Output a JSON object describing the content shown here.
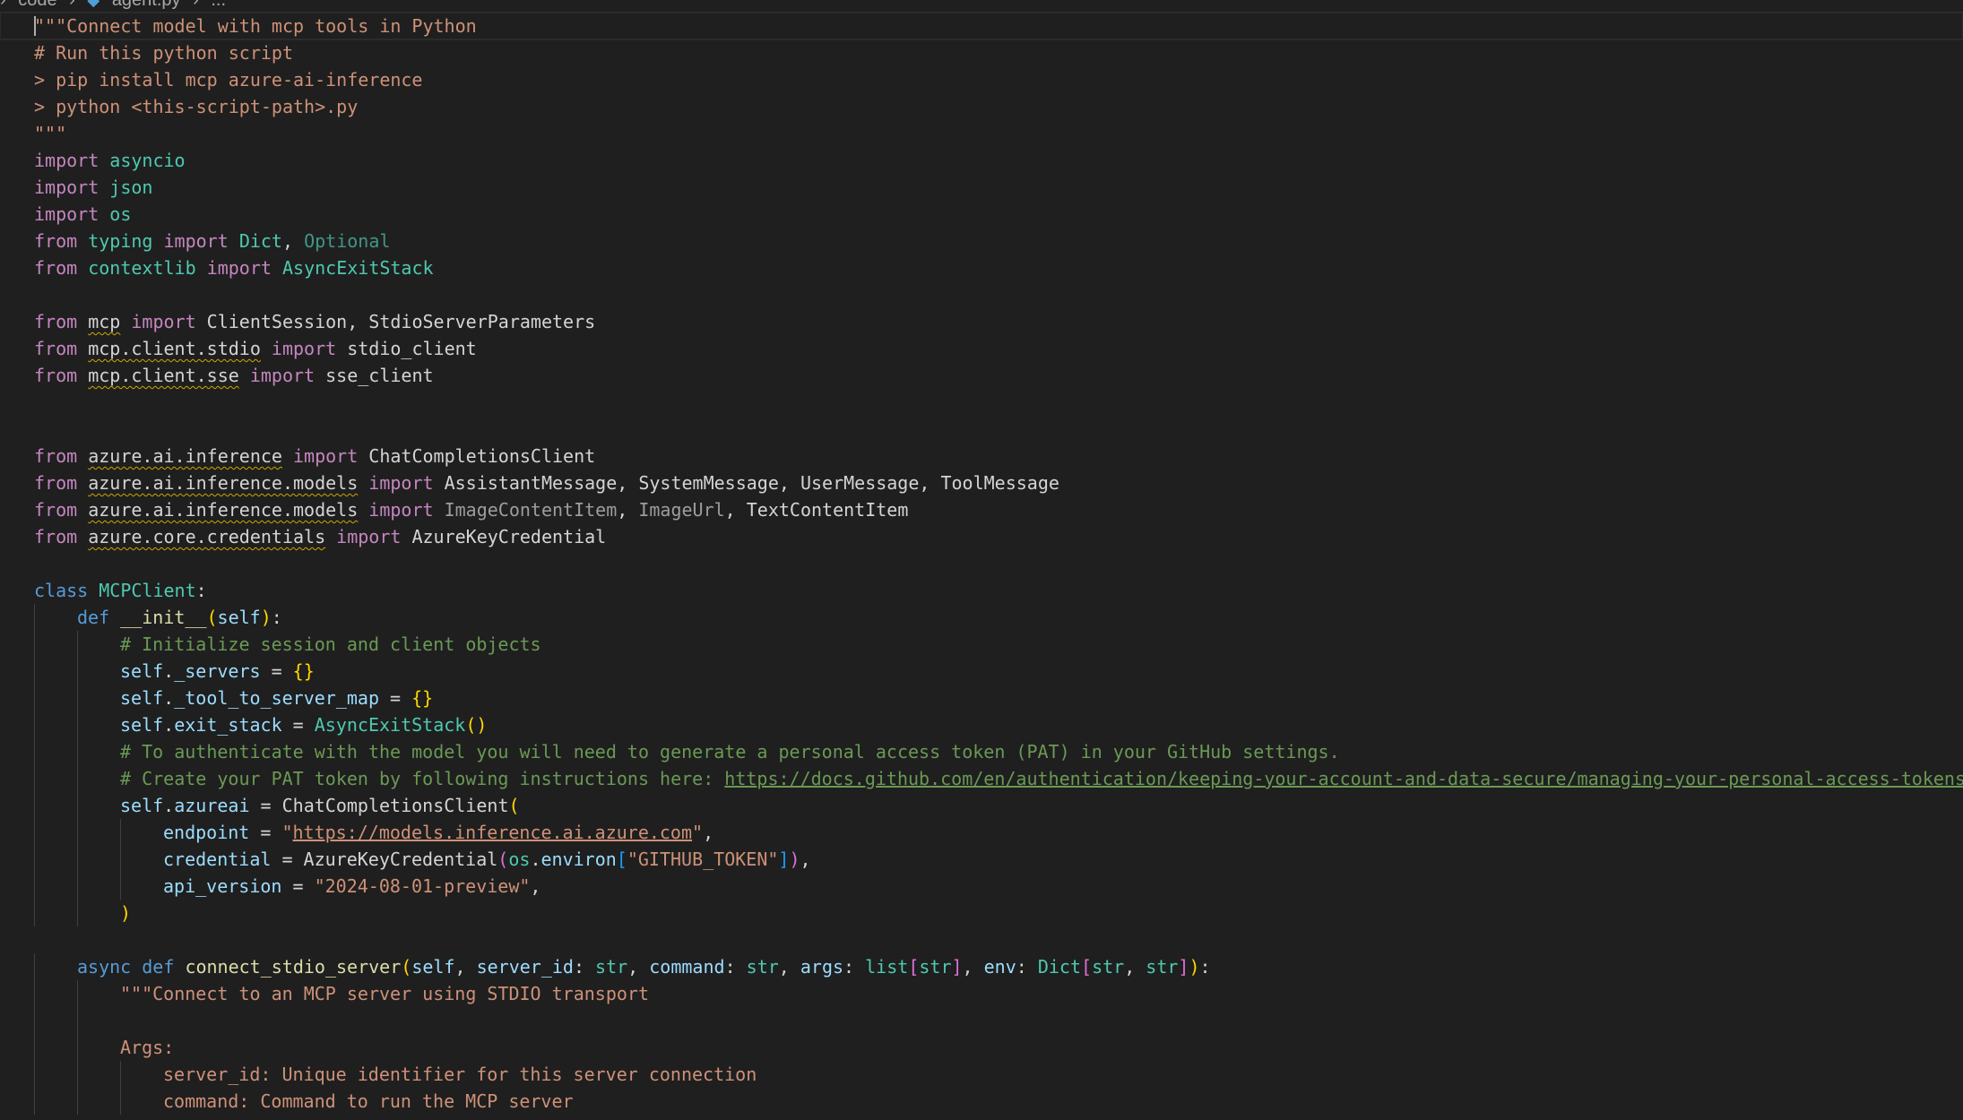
{
  "breadcrumb": {
    "folder": "code",
    "file": "agent.py",
    "more": "..."
  },
  "lines": [
    {
      "indent": 0,
      "current": true,
      "tokens": [
        {
          "t": "\"\"\"Connect model with mcp tools in Python",
          "c": "str"
        }
      ]
    },
    {
      "indent": 0,
      "tokens": [
        {
          "t": "# Run this python script",
          "c": "str"
        }
      ]
    },
    {
      "indent": 0,
      "tokens": [
        {
          "t": "> pip install mcp azure-ai-inference",
          "c": "str"
        }
      ]
    },
    {
      "indent": 0,
      "tokens": [
        {
          "t": "> python <this-script-path>.py",
          "c": "str"
        }
      ]
    },
    {
      "indent": 0,
      "tokens": [
        {
          "t": "\"\"\"",
          "c": "str"
        }
      ]
    },
    {
      "indent": 0,
      "tokens": [
        {
          "t": "import",
          "c": "kw"
        },
        {
          "t": " ",
          "c": "plain"
        },
        {
          "t": "asyncio",
          "c": "mod"
        }
      ]
    },
    {
      "indent": 0,
      "tokens": [
        {
          "t": "import",
          "c": "kw"
        },
        {
          "t": " ",
          "c": "plain"
        },
        {
          "t": "json",
          "c": "mod"
        }
      ]
    },
    {
      "indent": 0,
      "tokens": [
        {
          "t": "import",
          "c": "kw"
        },
        {
          "t": " ",
          "c": "plain"
        },
        {
          "t": "os",
          "c": "mod"
        }
      ]
    },
    {
      "indent": 0,
      "tokens": [
        {
          "t": "from",
          "c": "kw"
        },
        {
          "t": " ",
          "c": "plain"
        },
        {
          "t": "typing",
          "c": "mod"
        },
        {
          "t": " ",
          "c": "plain"
        },
        {
          "t": "import",
          "c": "kw"
        },
        {
          "t": " ",
          "c": "plain"
        },
        {
          "t": "Dict",
          "c": "cls"
        },
        {
          "t": ", ",
          "c": "plain"
        },
        {
          "t": "Optional",
          "c": "opt"
        }
      ]
    },
    {
      "indent": 0,
      "tokens": [
        {
          "t": "from",
          "c": "kw"
        },
        {
          "t": " ",
          "c": "plain"
        },
        {
          "t": "contextlib",
          "c": "mod"
        },
        {
          "t": " ",
          "c": "plain"
        },
        {
          "t": "import",
          "c": "kw"
        },
        {
          "t": " ",
          "c": "plain"
        },
        {
          "t": "AsyncExitStack",
          "c": "cls"
        }
      ]
    },
    {
      "indent": 0,
      "tokens": []
    },
    {
      "indent": 0,
      "tokens": [
        {
          "t": "from",
          "c": "kw"
        },
        {
          "t": " ",
          "c": "plain"
        },
        {
          "t": "mcp",
          "c": "plain",
          "sq": true
        },
        {
          "t": " ",
          "c": "plain"
        },
        {
          "t": "import",
          "c": "kw"
        },
        {
          "t": " ClientSession, StdioServerParameters",
          "c": "plain"
        }
      ]
    },
    {
      "indent": 0,
      "tokens": [
        {
          "t": "from",
          "c": "kw"
        },
        {
          "t": " ",
          "c": "plain"
        },
        {
          "t": "mcp.client.stdio",
          "c": "plain",
          "sq": true
        },
        {
          "t": " ",
          "c": "plain"
        },
        {
          "t": "import",
          "c": "kw"
        },
        {
          "t": " stdio_client",
          "c": "plain"
        }
      ]
    },
    {
      "indent": 0,
      "tokens": [
        {
          "t": "from",
          "c": "kw"
        },
        {
          "t": " ",
          "c": "plain"
        },
        {
          "t": "mcp.client.sse",
          "c": "plain",
          "sq": true
        },
        {
          "t": " ",
          "c": "plain"
        },
        {
          "t": "import",
          "c": "kw"
        },
        {
          "t": " sse_client",
          "c": "plain"
        }
      ]
    },
    {
      "indent": 0,
      "tokens": []
    },
    {
      "indent": 0,
      "tokens": []
    },
    {
      "indent": 0,
      "tokens": [
        {
          "t": "from",
          "c": "kw"
        },
        {
          "t": " ",
          "c": "plain"
        },
        {
          "t": "azure.ai.inference",
          "c": "plain",
          "sq": true
        },
        {
          "t": " ",
          "c": "plain"
        },
        {
          "t": "import",
          "c": "kw"
        },
        {
          "t": " ChatCompletionsClient",
          "c": "plain"
        }
      ]
    },
    {
      "indent": 0,
      "tokens": [
        {
          "t": "from",
          "c": "kw"
        },
        {
          "t": " ",
          "c": "plain"
        },
        {
          "t": "azure.ai.inference.models",
          "c": "plain",
          "sq": true
        },
        {
          "t": " ",
          "c": "plain"
        },
        {
          "t": "import",
          "c": "kw"
        },
        {
          "t": " AssistantMessage, SystemMessage, UserMessage, ToolMessage",
          "c": "plain"
        }
      ]
    },
    {
      "indent": 0,
      "tokens": [
        {
          "t": "from",
          "c": "kw"
        },
        {
          "t": " ",
          "c": "plain"
        },
        {
          "t": "azure.ai.inference.models",
          "c": "plain",
          "sq": true
        },
        {
          "t": " ",
          "c": "plain"
        },
        {
          "t": "import",
          "c": "kw"
        },
        {
          "t": " ",
          "c": "plain"
        },
        {
          "t": "ImageContentItem",
          "c": "dim"
        },
        {
          "t": ", ",
          "c": "plain"
        },
        {
          "t": "ImageUrl",
          "c": "dim"
        },
        {
          "t": ", TextContentItem",
          "c": "plain"
        }
      ]
    },
    {
      "indent": 0,
      "tokens": [
        {
          "t": "from",
          "c": "kw"
        },
        {
          "t": " ",
          "c": "plain"
        },
        {
          "t": "azure.core.credentials",
          "c": "plain",
          "sq": true
        },
        {
          "t": " ",
          "c": "plain"
        },
        {
          "t": "import",
          "c": "kw"
        },
        {
          "t": " AzureKeyCredential",
          "c": "plain"
        }
      ]
    },
    {
      "indent": 0,
      "tokens": []
    },
    {
      "indent": 0,
      "tokens": [
        {
          "t": "class",
          "c": "kw2"
        },
        {
          "t": " ",
          "c": "plain"
        },
        {
          "t": "MCPClient",
          "c": "cls"
        },
        {
          "t": ":",
          "c": "plain"
        }
      ]
    },
    {
      "indent": 1,
      "tokens": [
        {
          "t": "def",
          "c": "kw2"
        },
        {
          "t": " ",
          "c": "plain"
        },
        {
          "t": "__init__",
          "c": "fn"
        },
        {
          "t": "(",
          "c": "br1"
        },
        {
          "t": "self",
          "c": "var"
        },
        {
          "t": ")",
          "c": "br1"
        },
        {
          "t": ":",
          "c": "plain"
        }
      ]
    },
    {
      "indent": 2,
      "tokens": [
        {
          "t": "# Initialize session and client objects",
          "c": "cmt"
        }
      ]
    },
    {
      "indent": 2,
      "tokens": [
        {
          "t": "self",
          "c": "var"
        },
        {
          "t": ".",
          "c": "plain"
        },
        {
          "t": "_servers",
          "c": "var"
        },
        {
          "t": " = ",
          "c": "plain"
        },
        {
          "t": "{}",
          "c": "br1"
        }
      ]
    },
    {
      "indent": 2,
      "tokens": [
        {
          "t": "self",
          "c": "var"
        },
        {
          "t": ".",
          "c": "plain"
        },
        {
          "t": "_tool_to_server_map",
          "c": "var"
        },
        {
          "t": " = ",
          "c": "plain"
        },
        {
          "t": "{}",
          "c": "br1"
        }
      ]
    },
    {
      "indent": 2,
      "tokens": [
        {
          "t": "self",
          "c": "var"
        },
        {
          "t": ".",
          "c": "plain"
        },
        {
          "t": "exit_stack",
          "c": "var"
        },
        {
          "t": " = ",
          "c": "plain"
        },
        {
          "t": "AsyncExitStack",
          "c": "cls"
        },
        {
          "t": "()",
          "c": "br1"
        }
      ]
    },
    {
      "indent": 2,
      "tokens": [
        {
          "t": "# To authenticate with the model you will need to generate a personal access token (PAT) in your GitHub settings.",
          "c": "cmt"
        }
      ]
    },
    {
      "indent": 2,
      "tokens": [
        {
          "t": "# Create your PAT token by following instructions here: ",
          "c": "cmt"
        },
        {
          "t": "https://docs.github.com/en/authentication/keeping-your-account-and-data-secure/managing-your-personal-access-tokens",
          "c": "cmt",
          "link": true
        }
      ]
    },
    {
      "indent": 2,
      "tokens": [
        {
          "t": "self",
          "c": "var"
        },
        {
          "t": ".",
          "c": "plain"
        },
        {
          "t": "azureai",
          "c": "var"
        },
        {
          "t": " = ChatCompletionsClient",
          "c": "plain"
        },
        {
          "t": "(",
          "c": "br1"
        }
      ]
    },
    {
      "indent": 3,
      "tokens": [
        {
          "t": "endpoint",
          "c": "var"
        },
        {
          "t": " = ",
          "c": "plain"
        },
        {
          "t": "\"",
          "c": "str"
        },
        {
          "t": "https://models.inference.ai.azure.com",
          "c": "str",
          "link": true
        },
        {
          "t": "\"",
          "c": "str"
        },
        {
          "t": ",",
          "c": "plain"
        }
      ]
    },
    {
      "indent": 3,
      "tokens": [
        {
          "t": "credential",
          "c": "var"
        },
        {
          "t": " = AzureKeyCredential",
          "c": "plain"
        },
        {
          "t": "(",
          "c": "br2"
        },
        {
          "t": "os",
          "c": "mod"
        },
        {
          "t": ".",
          "c": "plain"
        },
        {
          "t": "environ",
          "c": "var"
        },
        {
          "t": "[",
          "c": "br3"
        },
        {
          "t": "\"GITHUB_TOKEN\"",
          "c": "str"
        },
        {
          "t": "]",
          "c": "br3"
        },
        {
          "t": ")",
          "c": "br2"
        },
        {
          "t": ",",
          "c": "plain"
        }
      ]
    },
    {
      "indent": 3,
      "tokens": [
        {
          "t": "api_version",
          "c": "var"
        },
        {
          "t": " = ",
          "c": "plain"
        },
        {
          "t": "\"2024-08-01-preview\"",
          "c": "str"
        },
        {
          "t": ",",
          "c": "plain"
        }
      ]
    },
    {
      "indent": 2,
      "tokens": [
        {
          "t": ")",
          "c": "br1"
        }
      ]
    },
    {
      "indent": 0,
      "tokens": []
    },
    {
      "indent": 1,
      "tokens": [
        {
          "t": "async",
          "c": "kw2"
        },
        {
          "t": " ",
          "c": "plain"
        },
        {
          "t": "def",
          "c": "kw2"
        },
        {
          "t": " ",
          "c": "plain"
        },
        {
          "t": "connect_stdio_server",
          "c": "fn"
        },
        {
          "t": "(",
          "c": "br1"
        },
        {
          "t": "self",
          "c": "var"
        },
        {
          "t": ", ",
          "c": "plain"
        },
        {
          "t": "server_id",
          "c": "var"
        },
        {
          "t": ": ",
          "c": "plain"
        },
        {
          "t": "str",
          "c": "cls"
        },
        {
          "t": ", ",
          "c": "plain"
        },
        {
          "t": "command",
          "c": "var"
        },
        {
          "t": ": ",
          "c": "plain"
        },
        {
          "t": "str",
          "c": "cls"
        },
        {
          "t": ", ",
          "c": "plain"
        },
        {
          "t": "args",
          "c": "var"
        },
        {
          "t": ": ",
          "c": "plain"
        },
        {
          "t": "list",
          "c": "cls"
        },
        {
          "t": "[",
          "c": "br2"
        },
        {
          "t": "str",
          "c": "cls"
        },
        {
          "t": "]",
          "c": "br2"
        },
        {
          "t": ", ",
          "c": "plain"
        },
        {
          "t": "env",
          "c": "var"
        },
        {
          "t": ": ",
          "c": "plain"
        },
        {
          "t": "Dict",
          "c": "cls"
        },
        {
          "t": "[",
          "c": "br2"
        },
        {
          "t": "str",
          "c": "cls"
        },
        {
          "t": ", ",
          "c": "plain"
        },
        {
          "t": "str",
          "c": "cls"
        },
        {
          "t": "]",
          "c": "br2"
        },
        {
          "t": ")",
          "c": "br1"
        },
        {
          "t": ":",
          "c": "plain"
        }
      ]
    },
    {
      "indent": 2,
      "tokens": [
        {
          "t": "\"\"\"Connect to an MCP server using STDIO transport",
          "c": "str"
        }
      ]
    },
    {
      "indent": 2,
      "tokens": []
    },
    {
      "indent": 2,
      "tokens": [
        {
          "t": "Args:",
          "c": "str"
        }
      ]
    },
    {
      "indent": 3,
      "tokens": [
        {
          "t": "server_id: Unique identifier for this server connection",
          "c": "str"
        }
      ]
    },
    {
      "indent": 3,
      "tokens": [
        {
          "t": "command: Command to run the MCP server",
          "c": "str"
        }
      ]
    }
  ]
}
